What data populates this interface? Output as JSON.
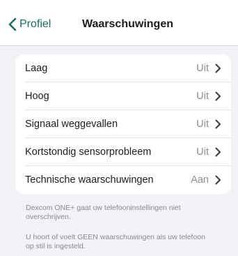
{
  "navbar": {
    "back_label": "Profiel",
    "title": "Waarschuwingen",
    "accent_color": "#156e63"
  },
  "alerts": [
    {
      "label": "Laag",
      "value": "Uit"
    },
    {
      "label": "Hoog",
      "value": "Uit"
    },
    {
      "label": "Signaal weggevallen",
      "value": "Uit"
    },
    {
      "label": "Kortstondig sensorprobleem",
      "value": "Uit"
    },
    {
      "label": "Technische waarschuwingen",
      "value": "Aan"
    }
  ],
  "footer": {
    "note1": "Dexcom ONE+ gaat uw telefooninstellingen niet overschrijven.",
    "note2": "U hoort of voelt GEEN waarschuwingen als uw telefoon op stil is ingesteld."
  },
  "icons": {
    "back": "chevron-left-icon",
    "row_chevron": "chevron-right-icon"
  }
}
